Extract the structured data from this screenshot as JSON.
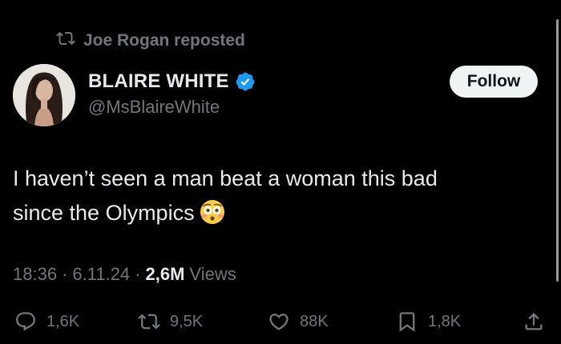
{
  "repost": {
    "label": "Joe Rogan reposted",
    "icon": "repost-icon"
  },
  "author": {
    "display_name": "BLAIRE WHITE",
    "handle": "@MsBlaireWhite",
    "verified": true,
    "verified_color": "#1d9bf0"
  },
  "follow_button": {
    "label": "Follow"
  },
  "tweet": {
    "line1": "I haven’t seen a man beat a woman this bad",
    "line2": "since the Olympics",
    "emoji": "flushed-face-emoji"
  },
  "meta": {
    "time": "18:36",
    "separator": "·",
    "date": "6.11.24",
    "views_count": "2,6M",
    "views_label": "Views"
  },
  "actions": {
    "replies": "1,6K",
    "reposts": "9,5K",
    "likes": "88K",
    "bookmarks": "1,8K"
  },
  "colors": {
    "background": "#000000",
    "text_primary": "#e7e9ea",
    "text_secondary": "#71767b",
    "button_bg": "#eff3f4"
  }
}
